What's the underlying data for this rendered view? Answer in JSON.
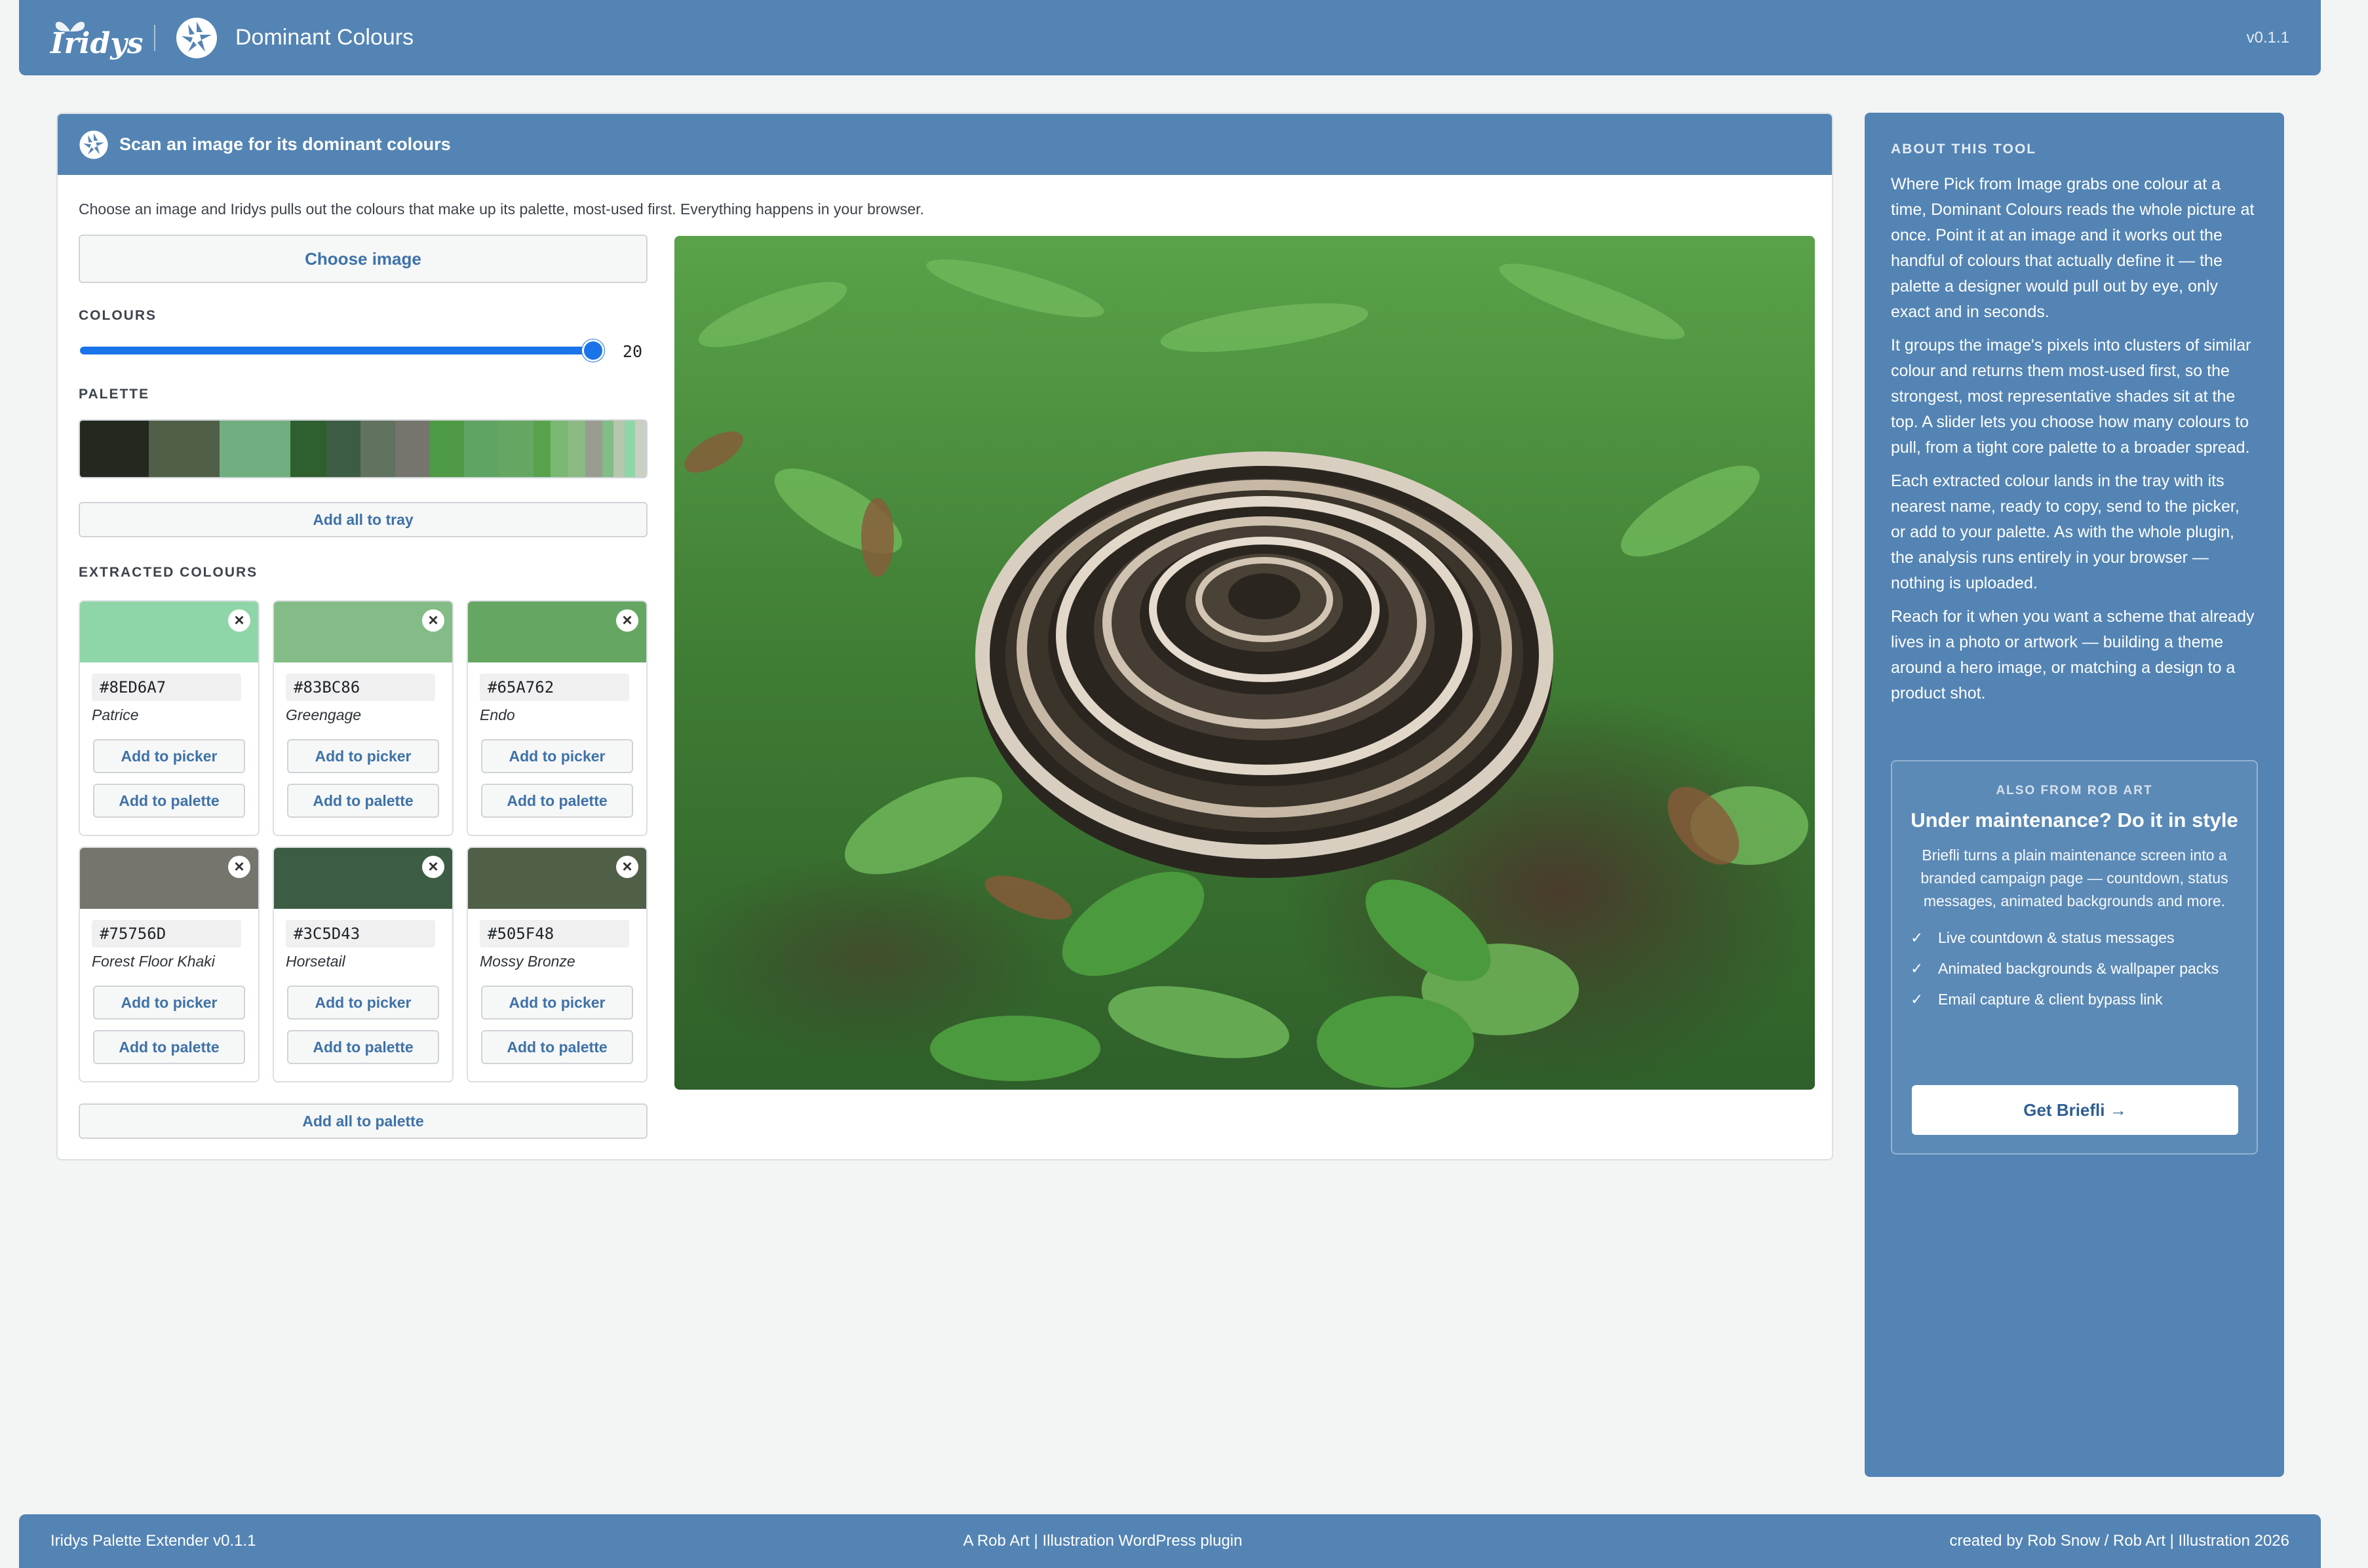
{
  "header": {
    "brand": "Iridys",
    "title": "Dominant Colours",
    "version": "v0.1.1"
  },
  "card": {
    "heading": "Scan an image for its dominant colours",
    "intro": "Choose an image and Iridys pulls out the colours that make up its palette, most-used first. Everything happens in your browser.",
    "choose_label": "Choose image",
    "colours_label": "COLOURS",
    "colours_value": "20",
    "colours_fraction": 1.0,
    "palette_label": "PALETTE",
    "add_all_tray": "Add all to tray",
    "extracted_label": "EXTRACTED COLOURS",
    "add_all_palette": "Add all to palette"
  },
  "palette_strip": [
    {
      "color": "#23291f",
      "weight": 44
    },
    {
      "color": "#505f48",
      "weight": 45
    },
    {
      "color": "#70ae80",
      "weight": 45
    },
    {
      "color": "#2f5f2f",
      "weight": 23
    },
    {
      "color": "#3c5d43",
      "weight": 22
    },
    {
      "color": "#61725f",
      "weight": 22
    },
    {
      "color": "#75756d",
      "weight": 22
    },
    {
      "color": "#4f9a46",
      "weight": 22
    },
    {
      "color": "#5fa462",
      "weight": 22
    },
    {
      "color": "#65a762",
      "weight": 22
    },
    {
      "color": "#58a24e",
      "weight": 11
    },
    {
      "color": "#7ab873",
      "weight": 11
    },
    {
      "color": "#8ab982",
      "weight": 11
    },
    {
      "color": "#9a9b91",
      "weight": 11
    },
    {
      "color": "#83bc86",
      "weight": 7
    },
    {
      "color": "#b5c8ae",
      "weight": 7
    },
    {
      "color": "#8ed6a7",
      "weight": 7
    },
    {
      "color": "#c9cfc2",
      "weight": 7
    }
  ],
  "swatches": [
    {
      "hex": "#8ED6A7",
      "name": "Patrice",
      "picker": "Add to picker",
      "palette": "Add to palette"
    },
    {
      "hex": "#83BC86",
      "name": "Greengage",
      "picker": "Add to picker",
      "palette": "Add to palette"
    },
    {
      "hex": "#65A762",
      "name": "Endo",
      "picker": "Add to picker",
      "palette": "Add to palette"
    },
    {
      "hex": "#75756D",
      "name": "Forest Floor Khaki",
      "picker": "Add to picker",
      "palette": "Add to palette"
    },
    {
      "hex": "#3C5D43",
      "name": "Horsetail",
      "picker": "Add to picker",
      "palette": "Add to palette"
    },
    {
      "hex": "#505F48",
      "name": "Mossy Bronze",
      "picker": "Add to picker",
      "palette": "Add to palette"
    }
  ],
  "sidebar": {
    "about_label": "ABOUT THIS TOOL",
    "paragraphs": [
      "Where Pick from Image grabs one colour at a time, Dominant Colours reads the whole picture at once. Point it at an image and it works out the handful of colours that actually define it — the palette a designer would pull out by eye, only exact and in seconds.",
      "It groups the image's pixels into clusters of similar colour and returns them most-used first, so the strongest, most representative shades sit at the top. A slider lets you choose how many colours to pull, from a tight core palette to a broader spread.",
      "Each extracted colour lands in the tray with its nearest name, ready to copy, send to the picker, or add to your palette. As with the whole plugin, the analysis runs entirely in your browser — nothing is uploaded.",
      "Reach for it when you want a scheme that already lives in a photo or artwork — building a theme around a hero image, or matching a design to a product shot."
    ],
    "promo": {
      "eyebrow": "ALSO FROM ROB ART",
      "title": "Under maintenance? Do it in style",
      "desc": "Briefli turns a plain maintenance screen into a branded campaign page — countdown, status messages, animated backgrounds and more.",
      "features": [
        "Live countdown & status messages",
        "Animated backgrounds & wallpaper packs",
        "Email capture & client bypass link"
      ],
      "cta": "Get Briefli →"
    }
  },
  "footer": {
    "left": "Iridys Palette Extender v0.1.1",
    "center": "A Rob Art | Illustration WordPress plugin",
    "right": "created by Rob Snow / Rob Art | Illustration 2026"
  },
  "icons": {
    "aperture": "aperture-icon",
    "close": "close-icon",
    "check": "check-icon"
  },
  "colors": {
    "accent": "#5384b4",
    "slider": "#1a73e8",
    "link": "#3e72a8"
  }
}
